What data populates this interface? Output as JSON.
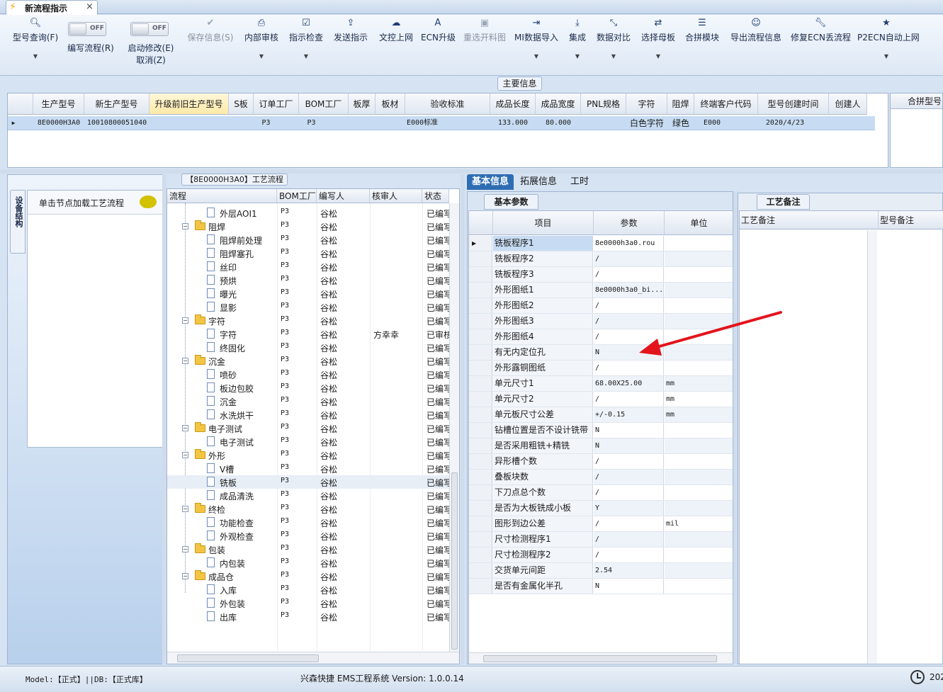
{
  "window": {
    "tab_title": "新流程指示",
    "close": "×"
  },
  "toolbar": {
    "query": "型号查询(F)",
    "write_flow": "编写流程(R)",
    "start_modify": "启动修改(E)",
    "cancel": "取消(Z)",
    "toggle_off": "OFF",
    "save": "保存信息(S)",
    "internal_audit": "内部审核",
    "check": "指示检查",
    "send": "发送指示",
    "file_upload": "文控上网",
    "ecn": "ECN升级",
    "reselect_image": "重选开料图",
    "mi_import": "MI数据导入",
    "integrate": "集成",
    "compare": "数据对比",
    "choose_master": "选择母板",
    "merge_module": "合拼模块",
    "export_flow": "导出流程信息",
    "fix_ecn": "修复ECN丢流程",
    "p2ecn": "P2ECN自动上网"
  },
  "main_info": {
    "label": "主要信息",
    "columns": [
      "生产型号",
      "新生产型号",
      "升级前旧生产型号",
      "S板",
      "订单工厂",
      "BOM工厂",
      "板厚",
      "板材",
      "验收标准",
      "成品长度",
      "成品宽度",
      "PNL规格",
      "字符",
      "阻焊",
      "终端客户代码",
      "型号创建时间",
      "创建人"
    ],
    "row": [
      "8E0000H3A0",
      "10010800051040",
      "",
      "",
      "P3",
      "P3",
      "",
      "",
      "E000标准",
      "133.000",
      "80.000",
      "",
      "白色字符",
      "绿色",
      "E000",
      "2020/4/23",
      ""
    ]
  },
  "merge_panel": {
    "label": "合拼型号"
  },
  "left_panel": {
    "vtab": "设备结构",
    "load_flow": "单击节点加载工艺流程"
  },
  "process": {
    "title": "【8E0000H3A0】工艺流程",
    "columns": [
      "流程",
      "BOM工厂",
      "编写人",
      "核审人",
      "状态"
    ],
    "rows": [
      {
        "name": "外层AOI1",
        "type": "leaf",
        "bom": "P3",
        "writer": "谷松",
        "reviewer": "",
        "status": "已编写"
      },
      {
        "name": "阻焊",
        "type": "folder",
        "bom": "P3",
        "writer": "谷松",
        "reviewer": "",
        "status": "已编写"
      },
      {
        "name": "阻焊前处理",
        "type": "leaf",
        "bom": "P3",
        "writer": "谷松",
        "reviewer": "",
        "status": "已编写"
      },
      {
        "name": "阻焊塞孔",
        "type": "leaf",
        "bom": "P3",
        "writer": "谷松",
        "reviewer": "",
        "status": "已编写"
      },
      {
        "name": "丝印",
        "type": "leaf",
        "bom": "P3",
        "writer": "谷松",
        "reviewer": "",
        "status": "已编写"
      },
      {
        "name": "预烘",
        "type": "leaf",
        "bom": "P3",
        "writer": "谷松",
        "reviewer": "",
        "status": "已编写"
      },
      {
        "name": "曝光",
        "type": "leaf",
        "bom": "P3",
        "writer": "谷松",
        "reviewer": "",
        "status": "已编写"
      },
      {
        "name": "显影",
        "type": "leaf",
        "bom": "P3",
        "writer": "谷松",
        "reviewer": "",
        "status": "已编写"
      },
      {
        "name": "字符",
        "type": "folder",
        "bom": "P3",
        "writer": "谷松",
        "reviewer": "",
        "status": "已编写"
      },
      {
        "name": "字符",
        "type": "leaf",
        "bom": "P3",
        "writer": "谷松",
        "reviewer": "方幸幸",
        "status": "已审核"
      },
      {
        "name": "终固化",
        "type": "leaf",
        "bom": "P3",
        "writer": "谷松",
        "reviewer": "",
        "status": "已编写"
      },
      {
        "name": "沉金",
        "type": "folder",
        "bom": "P3",
        "writer": "谷松",
        "reviewer": "",
        "status": "已编写"
      },
      {
        "name": "喷砂",
        "type": "leaf",
        "bom": "P3",
        "writer": "谷松",
        "reviewer": "",
        "status": "已编写"
      },
      {
        "name": "板边包胶",
        "type": "leaf",
        "bom": "P3",
        "writer": "谷松",
        "reviewer": "",
        "status": "已编写"
      },
      {
        "name": "沉金",
        "type": "leaf",
        "bom": "P3",
        "writer": "谷松",
        "reviewer": "",
        "status": "已编写"
      },
      {
        "name": "水洗烘干",
        "type": "leaf",
        "bom": "P3",
        "writer": "谷松",
        "reviewer": "",
        "status": "已编写"
      },
      {
        "name": "电子测试",
        "type": "folder",
        "bom": "P3",
        "writer": "谷松",
        "reviewer": "",
        "status": "已编写"
      },
      {
        "name": "电子测试",
        "type": "leaf",
        "bom": "P3",
        "writer": "谷松",
        "reviewer": "",
        "status": "已编写"
      },
      {
        "name": "外形",
        "type": "folder",
        "bom": "P3",
        "writer": "谷松",
        "reviewer": "",
        "status": "已编写"
      },
      {
        "name": "V槽",
        "type": "leaf",
        "bom": "P3",
        "writer": "谷松",
        "reviewer": "",
        "status": "已编写"
      },
      {
        "name": "铣板",
        "type": "leaf",
        "bom": "P3",
        "writer": "谷松",
        "reviewer": "",
        "status": "已编写",
        "selected": true
      },
      {
        "name": "成品清洗",
        "type": "leaf",
        "bom": "P3",
        "writer": "谷松",
        "reviewer": "",
        "status": "已编写"
      },
      {
        "name": "终检",
        "type": "folder",
        "bom": "P3",
        "writer": "谷松",
        "reviewer": "",
        "status": "已编写"
      },
      {
        "name": "功能检查",
        "type": "leaf",
        "bom": "P3",
        "writer": "谷松",
        "reviewer": "",
        "status": "已编写"
      },
      {
        "name": "外观检查",
        "type": "leaf",
        "bom": "P3",
        "writer": "谷松",
        "reviewer": "",
        "status": "已编写"
      },
      {
        "name": "包装",
        "type": "folder",
        "bom": "P3",
        "writer": "谷松",
        "reviewer": "",
        "status": "已编写"
      },
      {
        "name": "内包装",
        "type": "leaf",
        "bom": "P3",
        "writer": "谷松",
        "reviewer": "",
        "status": "已编写"
      },
      {
        "name": "成品仓",
        "type": "folder",
        "bom": "P3",
        "writer": "谷松",
        "reviewer": "",
        "status": "已编写"
      },
      {
        "name": "入库",
        "type": "leaf",
        "bom": "P3",
        "writer": "谷松",
        "reviewer": "",
        "status": "已编写"
      },
      {
        "name": "外包装",
        "type": "leaf",
        "bom": "P3",
        "writer": "谷松",
        "reviewer": "",
        "status": "已编写"
      },
      {
        "name": "出库",
        "type": "leaf",
        "bom": "P3",
        "writer": "谷松",
        "reviewer": "",
        "status": "已编写"
      }
    ]
  },
  "info_tabs": [
    "基本信息",
    "拓展信息",
    "工时"
  ],
  "params": {
    "subtab": "基本参数",
    "columns": [
      "项目",
      "参数",
      "单位"
    ],
    "rows": [
      {
        "k": "铣板程序1",
        "v": "8e0000h3a0.rou",
        "u": ""
      },
      {
        "k": "铣板程序2",
        "v": "/",
        "u": ""
      },
      {
        "k": "铣板程序3",
        "v": "/",
        "u": ""
      },
      {
        "k": "外形图纸1",
        "v": "8e0000h3a0_bi...",
        "u": ""
      },
      {
        "k": "外形图纸2",
        "v": "/",
        "u": ""
      },
      {
        "k": "外形图纸3",
        "v": "/",
        "u": ""
      },
      {
        "k": "外形图纸4",
        "v": "/",
        "u": ""
      },
      {
        "k": "有无内定位孔",
        "v": "N",
        "u": ""
      },
      {
        "k": "外形露铜图纸",
        "v": "/",
        "u": ""
      },
      {
        "k": "单元尺寸1",
        "v": "68.00X25.00",
        "u": "mm"
      },
      {
        "k": "单元尺寸2",
        "v": "/",
        "u": "mm"
      },
      {
        "k": "单元板尺寸公差",
        "v": "+/-0.15",
        "u": "mm"
      },
      {
        "k": "钻槽位置是否不设计铣带",
        "v": "N",
        "u": ""
      },
      {
        "k": "是否采用粗铣+精铣",
        "v": "N",
        "u": ""
      },
      {
        "k": "异形槽个数",
        "v": "/",
        "u": ""
      },
      {
        "k": "叠板块数",
        "v": "/",
        "u": ""
      },
      {
        "k": "下刀点总个数",
        "v": "/",
        "u": ""
      },
      {
        "k": "是否为大板铣成小板",
        "v": "Y",
        "u": ""
      },
      {
        "k": "图形到边公差",
        "v": "/",
        "u": "mil"
      },
      {
        "k": "尺寸检测程序1",
        "v": "/",
        "u": ""
      },
      {
        "k": "尺寸检测程序2",
        "v": "/",
        "u": ""
      },
      {
        "k": "交货单元间距",
        "v": "2.54",
        "u": ""
      },
      {
        "k": "是否有金属化半孔",
        "v": "N",
        "u": ""
      }
    ]
  },
  "notes": {
    "tab": "工艺备注",
    "col1": "工艺备注",
    "col2": "型号备注"
  },
  "status": {
    "model": "Model:【正式】||DB:【正式库】",
    "version": "兴森快捷 EMS工程系统 Version: 1.0.0.14",
    "year": "202"
  },
  "colors": {
    "accent": "#2e6db3",
    "arrow": "#e3141c",
    "selection": "#c7dcf3"
  }
}
